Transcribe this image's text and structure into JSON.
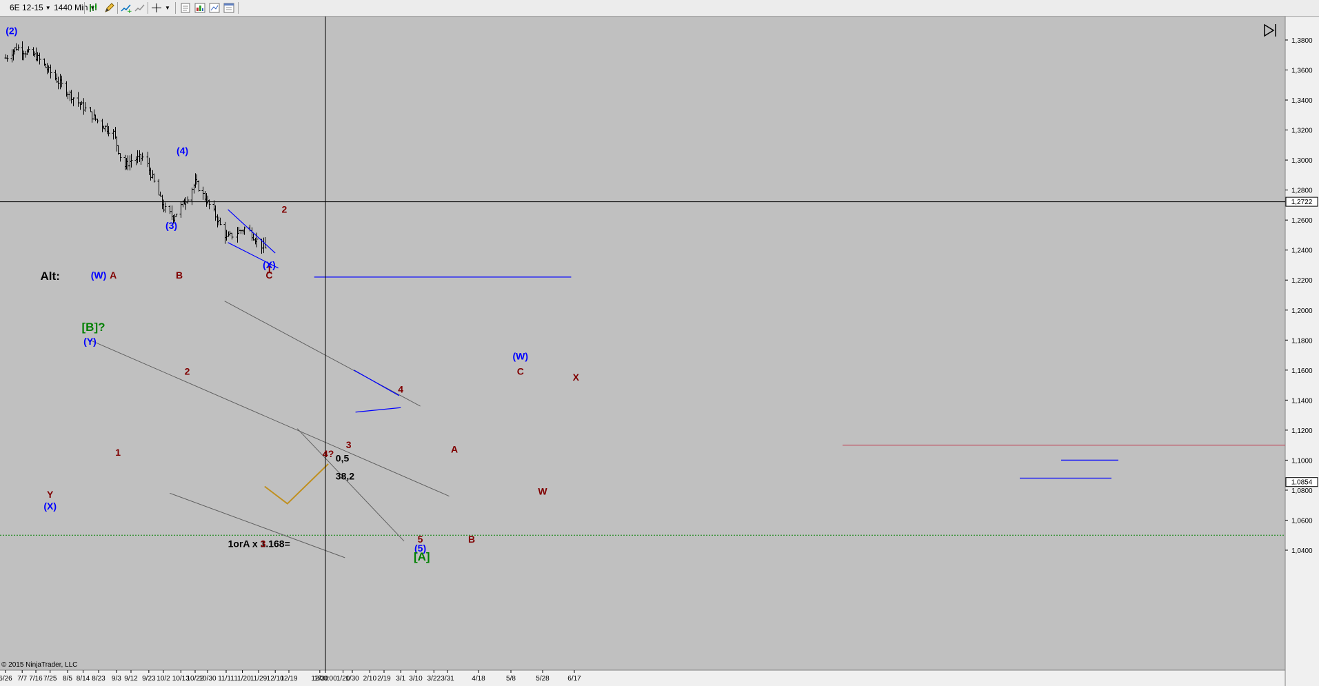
{
  "toolbar": {
    "instrument": "6E 12-15",
    "interval": "1440 Min",
    "icons": [
      "bar-style-icon",
      "pencil-draw-icon",
      "add-indicator-icon",
      "strategy-icon",
      "crosshair-icon",
      "new-chart-icon",
      "properties-icon",
      "data-box-icon",
      "chart-trader-icon"
    ]
  },
  "colors": {
    "background": "#c0c0c0",
    "bars": "#000000",
    "wave_primary": "#0000ff",
    "wave_minor": "#800000",
    "wave_green": "#008000",
    "trendline": "#606060",
    "pink_line": "#c05060",
    "support_line": "#008000",
    "projection": "#c09020"
  },
  "chart_data": {
    "type": "ohlc",
    "title": "",
    "xlabel": "",
    "ylabel": "",
    "ylim": [
      1.03,
      1.395
    ],
    "grid": false,
    "x_ticks": [
      "6/26",
      "7/16",
      "8/5",
      "8/23",
      "9/12",
      "10/2",
      "10/22",
      "11/11",
      "11/29",
      "12/19",
      "1/00:00",
      "1/30",
      "2/19",
      "3/10",
      "3/31",
      "4/18",
      "5/8",
      "5/28",
      "6/17",
      "7/7",
      "7/25",
      "8/14",
      "9/3",
      "9/23",
      "10/13",
      "10/30",
      "11/20",
      "12/10",
      "12/30",
      "1/20",
      "2/10",
      "3/1",
      "3/22"
    ],
    "y_ticks": [
      "1,3800",
      "1,3600",
      "1,3400",
      "1,3200",
      "1,3000",
      "1,2800",
      "1,2600",
      "1,2400",
      "1,2200",
      "1,2000",
      "1,1800",
      "1,1600",
      "1,1400",
      "1,1200",
      "1,1000",
      "1,0800",
      "1,0600",
      "1,0400"
    ],
    "y_tick_values": [
      1.38,
      1.36,
      1.34,
      1.32,
      1.3,
      1.28,
      1.26,
      1.24,
      1.22,
      1.2,
      1.18,
      1.16,
      1.14,
      1.12,
      1.1,
      1.08,
      1.06,
      1.04
    ],
    "last_price": "1,0854",
    "last_price_value": 1.0854,
    "crosshair_price": "1,2722",
    "crosshair_price_value": 1.2722,
    "crosshair_x_label": "1/00:00",
    "price_path": [
      {
        "x": "6/26",
        "y": 1.368
      },
      {
        "x": "7/3",
        "y": 1.375
      },
      {
        "x": "7/16",
        "y": 1.369
      },
      {
        "x": "8/5",
        "y": 1.345
      },
      {
        "x": "8/23",
        "y": 1.325
      },
      {
        "x": "9/1",
        "y": 1.318
      },
      {
        "x": "9/7",
        "y": 1.295
      },
      {
        "x": "9/12",
        "y": 1.3
      },
      {
        "x": "9/20",
        "y": 1.302
      },
      {
        "x": "10/2",
        "y": 1.268
      },
      {
        "x": "10/8",
        "y": 1.262
      },
      {
        "x": "10/15",
        "y": 1.272
      },
      {
        "x": "10/22",
        "y": 1.285
      },
      {
        "x": "11/3",
        "y": 1.265
      },
      {
        "x": "11/11",
        "y": 1.248
      },
      {
        "x": "11/22",
        "y": 1.255
      },
      {
        "x": "11/29",
        "y": 1.245
      },
      {
        "x": "12/8",
        "y": 1.236
      },
      {
        "x": "12/16",
        "y": 1.258
      },
      {
        "x": "12/19",
        "y": 1.237
      },
      {
        "x": "12/28",
        "y": 1.215
      },
      {
        "x": "1/00:00",
        "y": 1.196
      },
      {
        "x": "1/20",
        "y": 1.16
      },
      {
        "x": "1/26",
        "y": 1.12
      },
      {
        "x": "1/30",
        "y": 1.14
      },
      {
        "x": "2/19",
        "y": 1.142
      },
      {
        "x": "2/26",
        "y": 1.128
      },
      {
        "x": "3/3",
        "y": 1.1
      },
      {
        "x": "3/10",
        "y": 1.06
      },
      {
        "x": "3/13",
        "y": 1.052
      },
      {
        "x": "3/20",
        "y": 1.08
      },
      {
        "x": "3/26",
        "y": 1.09
      },
      {
        "x": "4/4",
        "y": 1.098
      },
      {
        "x": "4/13",
        "y": 1.058
      },
      {
        "x": "4/18",
        "y": 1.072
      },
      {
        "x": "4/27",
        "y": 1.092
      },
      {
        "x": "5/8",
        "y": 1.138
      },
      {
        "x": "5/15",
        "y": 1.145
      },
      {
        "x": "5/26",
        "y": 1.092
      },
      {
        "x": "5/28",
        "y": 1.088
      },
      {
        "x": "6/6",
        "y": 1.128
      },
      {
        "x": "6/17",
        "y": 1.14
      },
      {
        "x": "6/24",
        "y": 1.13
      },
      {
        "x": "7/7",
        "y": 1.1
      },
      {
        "x": "7/20",
        "y": 1.09
      },
      {
        "x": "7/25",
        "y": 1.094
      },
      {
        "x": "8/5",
        "y": 1.095
      },
      {
        "x": "8/11",
        "y": 1.112
      },
      {
        "x": "8/20",
        "y": 1.12
      },
      {
        "x": "8/24",
        "y": 1.165
      },
      {
        "x": "9/3",
        "y": 1.115
      },
      {
        "x": "9/10",
        "y": 1.122
      },
      {
        "x": "9/23",
        "y": 1.12
      },
      {
        "x": "10/5",
        "y": 1.128
      },
      {
        "x": "10/13",
        "y": 1.135
      },
      {
        "x": "10/15",
        "y": 1.145
      },
      {
        "x": "10/23",
        "y": 1.112
      },
      {
        "x": "11/2",
        "y": 1.098
      },
      {
        "x": "11/10",
        "y": 1.075
      },
      {
        "x": "11/20",
        "y": 1.065
      },
      {
        "x": "12/2",
        "y": 1.056
      },
      {
        "x": "12/3",
        "y": 1.09
      }
    ],
    "trendlines": [
      {
        "name": "upper-channel",
        "from": {
          "x": "3/13",
          "y": 1.136
        },
        "to": {
          "x": "11/10",
          "y": 1.206
        }
      },
      {
        "name": "lower-channel",
        "from": {
          "x": "3/3",
          "y": 1.046
        },
        "to": {
          "x": "12/22",
          "y": 1.121
        }
      },
      {
        "name": "down-channel-upper",
        "from": {
          "x": "8/18",
          "y": 1.18
        },
        "to": {
          "x": "4/1",
          "y": 1.076
        }
      },
      {
        "name": "down-channel-lower",
        "from": {
          "x": "10/6",
          "y": 1.078
        },
        "to": {
          "x": "1/22",
          "y": 1.035
        }
      },
      {
        "name": "wedge-upper",
        "from": {
          "x": "11/12",
          "y": 1.267
        },
        "to": {
          "x": "12/10",
          "y": 1.238
        }
      },
      {
        "name": "wedge-lower",
        "from": {
          "x": "11/12",
          "y": 1.245
        },
        "to": {
          "x": "12/12",
          "y": 1.228
        }
      },
      {
        "name": "triangle-upper",
        "from": {
          "x": "1/31",
          "y": 1.16
        },
        "to": {
          "x": "2/28",
          "y": 1.143
        }
      },
      {
        "name": "triangle-lower",
        "from": {
          "x": "2/1",
          "y": 1.132
        },
        "to": {
          "x": "3/1",
          "y": 1.135
        }
      },
      {
        "name": "alt-horizontal",
        "from": {
          "x": "6/15",
          "y": 1.222
        },
        "to": {
          "x": "12/28",
          "y": 1.222
        }
      }
    ],
    "horizontal_levels": [
      {
        "name": "pink-resistance",
        "y": 1.11
      },
      {
        "name": "green-support",
        "y": 1.05
      },
      {
        "name": "fib-50",
        "y": 1.1
      },
      {
        "name": "fib-382",
        "y": 1.088
      }
    ],
    "projection_path": [
      {
        "x": "12/3",
        "y": 1.0825
      },
      {
        "x": "12/18",
        "y": 1.071
      },
      {
        "x": "1/4",
        "y": 1.0975
      }
    ],
    "annotations": [
      {
        "text": "(2)",
        "x": "6/30",
        "y": 1.384,
        "color": "wave_primary"
      },
      {
        "text": "(4)",
        "x": "10/14",
        "y": 1.304,
        "color": "wave_primary"
      },
      {
        "text": "(3)",
        "x": "10/7",
        "y": 1.254,
        "color": "wave_primary"
      },
      {
        "text": "2",
        "x": "12/16",
        "y": 1.265,
        "color": "wave_minor"
      },
      {
        "text": "1",
        "x": "12/6",
        "y": 1.225,
        "color": "wave_minor"
      },
      {
        "text": "4",
        "x": "3/1",
        "y": 1.145,
        "color": "wave_minor"
      },
      {
        "text": "3",
        "x": "1/26",
        "y": 1.108,
        "color": "wave_minor"
      },
      {
        "text": "A",
        "x": "4/4",
        "y": 1.105,
        "color": "wave_minor"
      },
      {
        "text": "5",
        "x": "3/13",
        "y": 1.045,
        "color": "wave_minor"
      },
      {
        "text": "(5)",
        "x": "3/13",
        "y": 1.039,
        "color": "wave_primary"
      },
      {
        "text": "[A]",
        "x": "3/14",
        "y": 1.033,
        "color": "wave_green"
      },
      {
        "text": "B",
        "x": "4/14",
        "y": 1.045,
        "color": "wave_minor"
      },
      {
        "text": "(W)",
        "x": "5/14",
        "y": 1.167,
        "color": "wave_primary"
      },
      {
        "text": "C",
        "x": "5/14",
        "y": 1.157,
        "color": "wave_minor"
      },
      {
        "text": "W",
        "x": "5/28",
        "y": 1.077,
        "color": "wave_minor"
      },
      {
        "text": "X",
        "x": "6/18",
        "y": 1.153,
        "color": "wave_minor"
      },
      {
        "text": "Y",
        "x": "7/25",
        "y": 1.075,
        "color": "wave_minor"
      },
      {
        "text": "(X)",
        "x": "7/25",
        "y": 1.067,
        "color": "wave_primary"
      },
      {
        "text": "[B]?",
        "x": "8/20",
        "y": 1.186,
        "color": "wave_green"
      },
      {
        "text": "(Y)",
        "x": "8/18",
        "y": 1.177,
        "color": "wave_primary"
      },
      {
        "text": "1",
        "x": "9/4",
        "y": 1.103,
        "color": "wave_minor"
      },
      {
        "text": "2",
        "x": "10/17",
        "y": 1.157,
        "color": "wave_minor"
      },
      {
        "text": "Alt:",
        "x": "7/25",
        "y": 1.22,
        "color": "bars"
      },
      {
        "text": "(W)",
        "x": "8/23",
        "y": 1.221,
        "color": "wave_primary"
      },
      {
        "text": "A",
        "x": "9/1",
        "y": 1.221,
        "color": "wave_minor"
      },
      {
        "text": "B",
        "x": "10/12",
        "y": 1.221,
        "color": "wave_minor"
      },
      {
        "text": "(X)",
        "x": "12/6",
        "y": 1.228,
        "color": "wave_primary"
      },
      {
        "text": "C",
        "x": "12/6",
        "y": 1.221,
        "color": "wave_minor"
      },
      {
        "text": "4?",
        "x": "12/31",
        "y": 1.102,
        "color": "wave_minor"
      },
      {
        "text": "0,5",
        "x": "1/12",
        "y": 1.099,
        "color": "bars"
      },
      {
        "text": "38,2",
        "x": "1/12",
        "y": 1.087,
        "color": "bars"
      },
      {
        "text": "1orA x 1.168=",
        "x": "11/12",
        "y": 1.042,
        "color": "bars"
      },
      {
        "text": "3",
        "x": "12/2",
        "y": 1.042,
        "color": "wave_minor"
      }
    ],
    "copyright": "© 2015 NinjaTrader, LLC"
  }
}
